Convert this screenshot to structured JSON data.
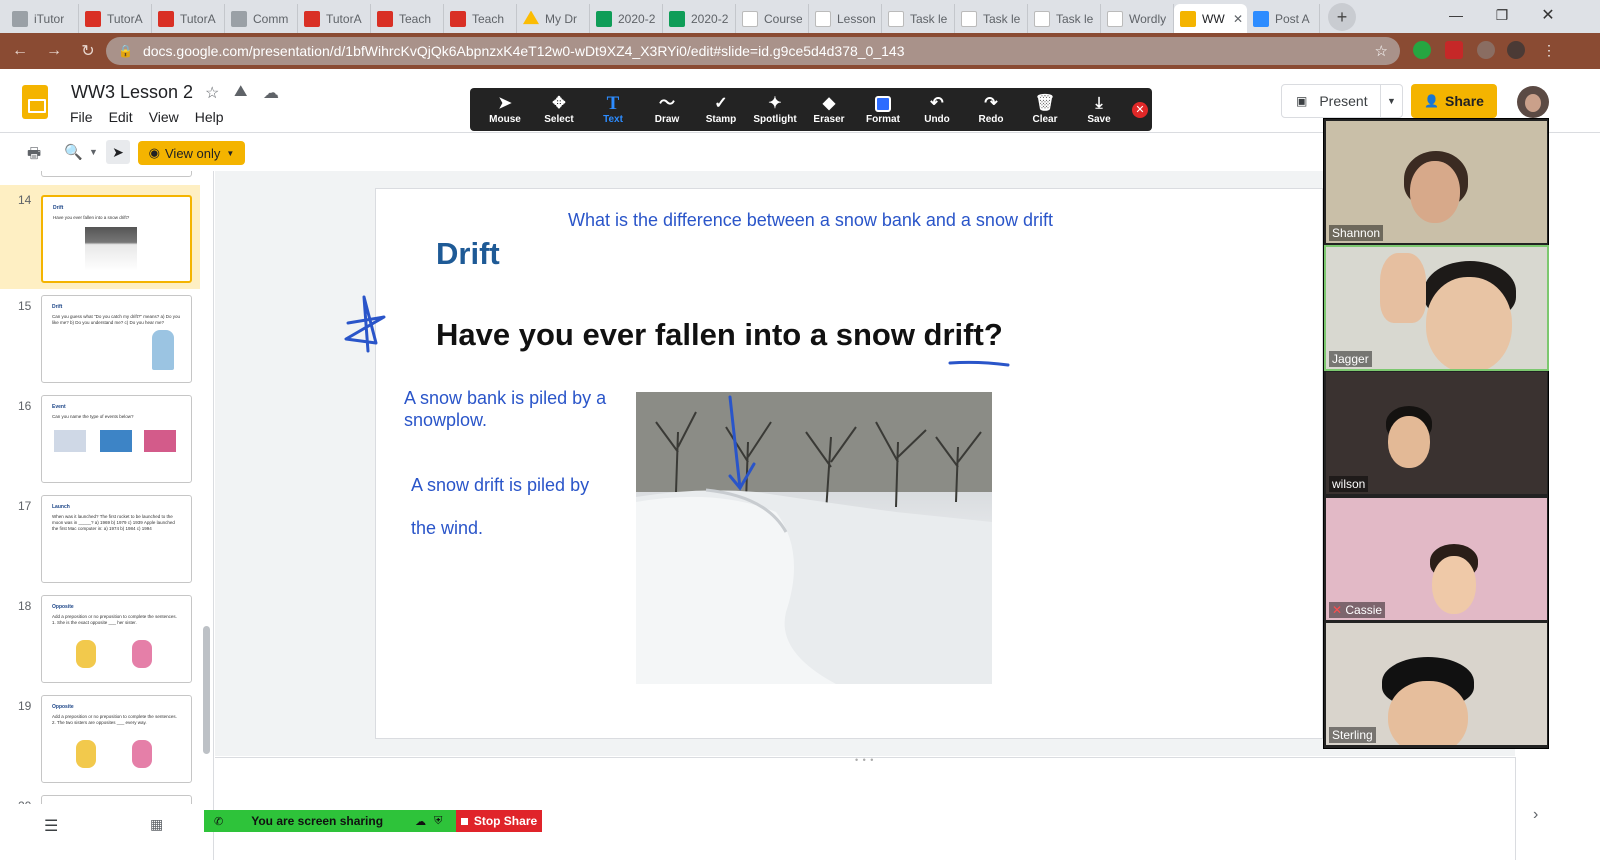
{
  "browser": {
    "tabs": [
      {
        "label": "iTutor",
        "icon": "itutor-icon",
        "fav": "fav-itutor"
      },
      {
        "label": "TutorA",
        "icon": "tutor-icon",
        "fav": "fav-tutor"
      },
      {
        "label": "TutorA",
        "icon": "tutor-icon",
        "fav": "fav-tutor"
      },
      {
        "label": "Comm",
        "icon": "globe-icon",
        "fav": "fav-comm"
      },
      {
        "label": "TutorA",
        "icon": "tutor-icon",
        "fav": "fav-tutor"
      },
      {
        "label": "Teach",
        "icon": "tutor-icon",
        "fav": "fav-tutor"
      },
      {
        "label": "Teach",
        "icon": "tutor-icon",
        "fav": "fav-tutor"
      },
      {
        "label": "My Dr",
        "icon": "google-drive-icon",
        "fav": "fav-drive"
      },
      {
        "label": "2020-2",
        "icon": "google-sheets-icon",
        "fav": "fav-sheets"
      },
      {
        "label": "2020-2",
        "icon": "google-sheets-icon",
        "fav": "fav-sheets"
      },
      {
        "label": "Course",
        "icon": "document-icon",
        "fav": "fav-doc"
      },
      {
        "label": "Lesson",
        "icon": "document-icon",
        "fav": "fav-doc"
      },
      {
        "label": "Task le",
        "icon": "document-icon",
        "fav": "fav-doc"
      },
      {
        "label": "Task le",
        "icon": "document-icon",
        "fav": "fav-doc"
      },
      {
        "label": "Task le",
        "icon": "document-icon",
        "fav": "fav-doc"
      },
      {
        "label": "Wordly",
        "icon": "document-icon",
        "fav": "fav-doc"
      },
      {
        "label": "WW",
        "icon": "google-slides-icon",
        "fav": "fav-slides",
        "active": true
      },
      {
        "label": "Post A",
        "icon": "zoom-icon",
        "fav": "fav-zoom"
      }
    ],
    "url": "docs.google.com/presentation/d/1bfWihrcKvQjQk6AbpnzxK4eT12w0-wDt9XZ4_X3RYi0/edit#slide=id.g9ce5d4d378_0_143"
  },
  "doc": {
    "title": "WW3 Lesson 2",
    "menu": [
      "File",
      "Edit",
      "View",
      "Help"
    ],
    "present_label": "Present",
    "share_label": "Share",
    "view_only_label": "View only"
  },
  "annotation_toolbar": {
    "tools": [
      {
        "label": "Mouse",
        "icon": "mouse-pointer-icon",
        "glyph": "➤"
      },
      {
        "label": "Select",
        "icon": "move-arrows-icon",
        "glyph": "✥"
      },
      {
        "label": "Text",
        "icon": "text-icon",
        "glyph": "T",
        "selected": true
      },
      {
        "label": "Draw",
        "icon": "squiggle-icon",
        "glyph": "〜"
      },
      {
        "label": "Stamp",
        "icon": "checkmark-icon",
        "glyph": "✓"
      },
      {
        "label": "Spotlight",
        "icon": "magic-wand-icon",
        "glyph": "✦"
      },
      {
        "label": "Eraser",
        "icon": "eraser-icon",
        "glyph": "◆"
      },
      {
        "label": "Format",
        "icon": "format-color-icon",
        "glyph": ""
      },
      {
        "label": "Undo",
        "icon": "undo-icon",
        "glyph": "↶"
      },
      {
        "label": "Redo",
        "icon": "redo-icon",
        "glyph": "↷"
      },
      {
        "label": "Clear",
        "icon": "trash-icon",
        "glyph": "🗑"
      },
      {
        "label": "Save",
        "icon": "save-download-icon",
        "glyph": "⤓"
      }
    ]
  },
  "filmstrip": {
    "slides": [
      {
        "num": "14",
        "title": "Drift",
        "text": "Have you ever fallen into a snow drift?",
        "selected": true
      },
      {
        "num": "15",
        "title": "Drift",
        "text": "Can you guess what \"Do you catch my drift?\" means? a) Do you like me? b) Do you understand me? c) Do you hear me?"
      },
      {
        "num": "16",
        "title": "Event",
        "text": "Can you name the type of events below?"
      },
      {
        "num": "17",
        "title": "Launch",
        "text": "When was it launched? The first rocket to be launched to the moon was in _____? a) 1969 b) 1979 c) 1939 Apple launched the first Mac computer in: a) 1974 b) 1984 c) 1994"
      },
      {
        "num": "18",
        "title": "Opposite",
        "text": "Add a preposition or no preposition to complete the sentences. 1. She is the exact opposite ___ her sister."
      },
      {
        "num": "19",
        "title": "Opposite",
        "text": "Add a preposition or no preposition to complete the sentences. 2. The two sisters are opposites ___ every way."
      },
      {
        "num": "20",
        "title": "",
        "text": ""
      }
    ]
  },
  "slide": {
    "title": "Drift",
    "question_prefix": "Have you ever fallen into a snow ",
    "question_word": "drift",
    "question_suffix": "?",
    "annotation_top": "What is the difference between a snow bank and a snow drift",
    "annotation_bank": "A snow bank is piled by a snowplow.",
    "annotation_drift_1": "A snow drift is piled by",
    "annotation_drift_2": "the wind."
  },
  "zoom": {
    "sharing_message": "You are screen sharing",
    "stop_share_label": "Stop Share",
    "participants": [
      {
        "name": "Shannon",
        "bg": "#c9bfa8"
      },
      {
        "name": "Jagger",
        "bg": "#d8d8d0",
        "speaking": true
      },
      {
        "name": "wilson",
        "bg": "#3a3230"
      },
      {
        "name": "Cassie",
        "bg": "#e2b9c6",
        "muted": true
      },
      {
        "name": "Sterling",
        "bg": "#d9d4cc"
      }
    ]
  },
  "colors": {
    "slides_yellow": "#f4b400",
    "annotation_blue": "#2a55c9",
    "title_blue": "#1e5a96",
    "share_green": "#2ec33a",
    "stop_red": "#e0242a"
  }
}
